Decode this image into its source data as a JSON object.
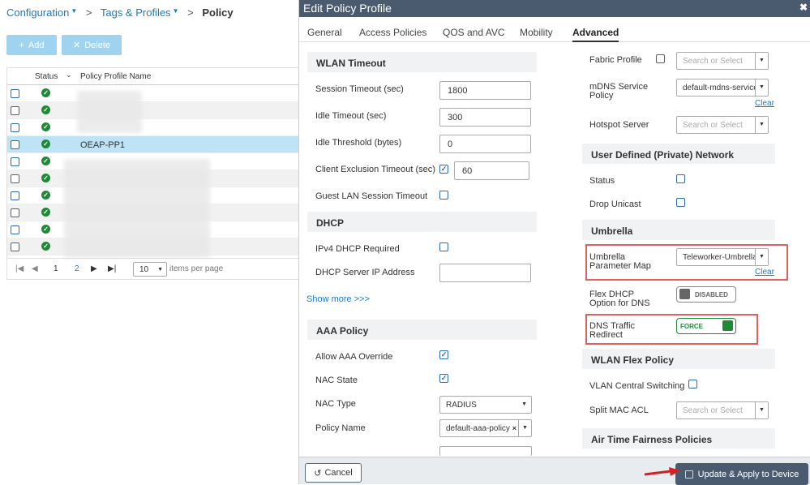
{
  "breadcrumb": {
    "configuration": "Configuration",
    "tags_profiles": "Tags & Profiles",
    "policy": "Policy"
  },
  "toolbar": {
    "add_label": "Add",
    "delete_label": "Delete"
  },
  "table": {
    "headers": {
      "status": "Status",
      "name": "Policy Profile Name"
    },
    "selected_row_name": "OEAP-PP1",
    "row_count": 10,
    "pager": {
      "page1": "1",
      "page2": "2",
      "per_page_value": "10",
      "per_page_label": "items per page"
    }
  },
  "modal": {
    "title": "Edit Policy Profile",
    "tabs": [
      "General",
      "Access Policies",
      "QOS and AVC",
      "Mobility",
      "Advanced"
    ],
    "active_tab": "Advanced",
    "left": {
      "wlan_timeout": {
        "heading": "WLAN Timeout",
        "session_timeout_label": "Session Timeout (sec)",
        "session_timeout": "1800",
        "idle_timeout_label": "Idle Timeout (sec)",
        "idle_timeout": "300",
        "idle_threshold_label": "Idle Threshold (bytes)",
        "idle_threshold": "0",
        "client_exclusion_label": "Client Exclusion Timeout (sec)",
        "client_exclusion": "60",
        "guest_lan_label": "Guest LAN Session Timeout"
      },
      "dhcp": {
        "heading": "DHCP",
        "ipv4_required_label": "IPv4 DHCP Required",
        "server_ip_label": "DHCP Server IP Address",
        "server_ip": ""
      },
      "show_more": "Show more >>>",
      "aaa": {
        "heading": "AAA Policy",
        "allow_override_label": "Allow AAA Override",
        "nac_state_label": "NAC State",
        "nac_type_label": "NAC Type",
        "nac_type": "RADIUS",
        "policy_name_label": "Policy Name",
        "policy_name": "default-aaa-policy"
      }
    },
    "right": {
      "fabric_profile_label": "Fabric Profile",
      "fabric_profile_placeholder": "Search or Select",
      "mdns_label": "mDNS Service Policy",
      "mdns_value": "default-mdns-service",
      "clear": "Clear",
      "hotspot_label": "Hotspot Server",
      "hotspot_placeholder": "Search or Select",
      "udn_heading": "User Defined (Private) Network",
      "udn_status_label": "Status",
      "udn_drop_unicast_label": "Drop Unicast",
      "umbrella_heading": "Umbrella",
      "umbrella_map_label": "Umbrella Parameter Map",
      "umbrella_map_value": "Teleworker-Umbrella",
      "flex_dhcp_label": "Flex DHCP Option for DNS",
      "flex_dhcp_state": "DISABLED",
      "dns_redirect_label": "DNS Traffic Redirect",
      "dns_redirect_state": "FORCE",
      "wlan_flex_heading": "WLAN Flex Policy",
      "vlan_central_label": "VLAN Central Switching",
      "split_mac_label": "Split MAC ACL",
      "split_mac_placeholder": "Search or Select",
      "atf_heading": "Air Time Fairness Policies"
    },
    "footer": {
      "cancel": "Cancel",
      "apply": "Update & Apply to Device"
    }
  },
  "colors": {
    "accent": "#1b7ac2",
    "header_bg": "#4a5b6f",
    "status_ok": "#1e8a36",
    "highlight": "#e06060",
    "force_on": "#1e8a36"
  }
}
